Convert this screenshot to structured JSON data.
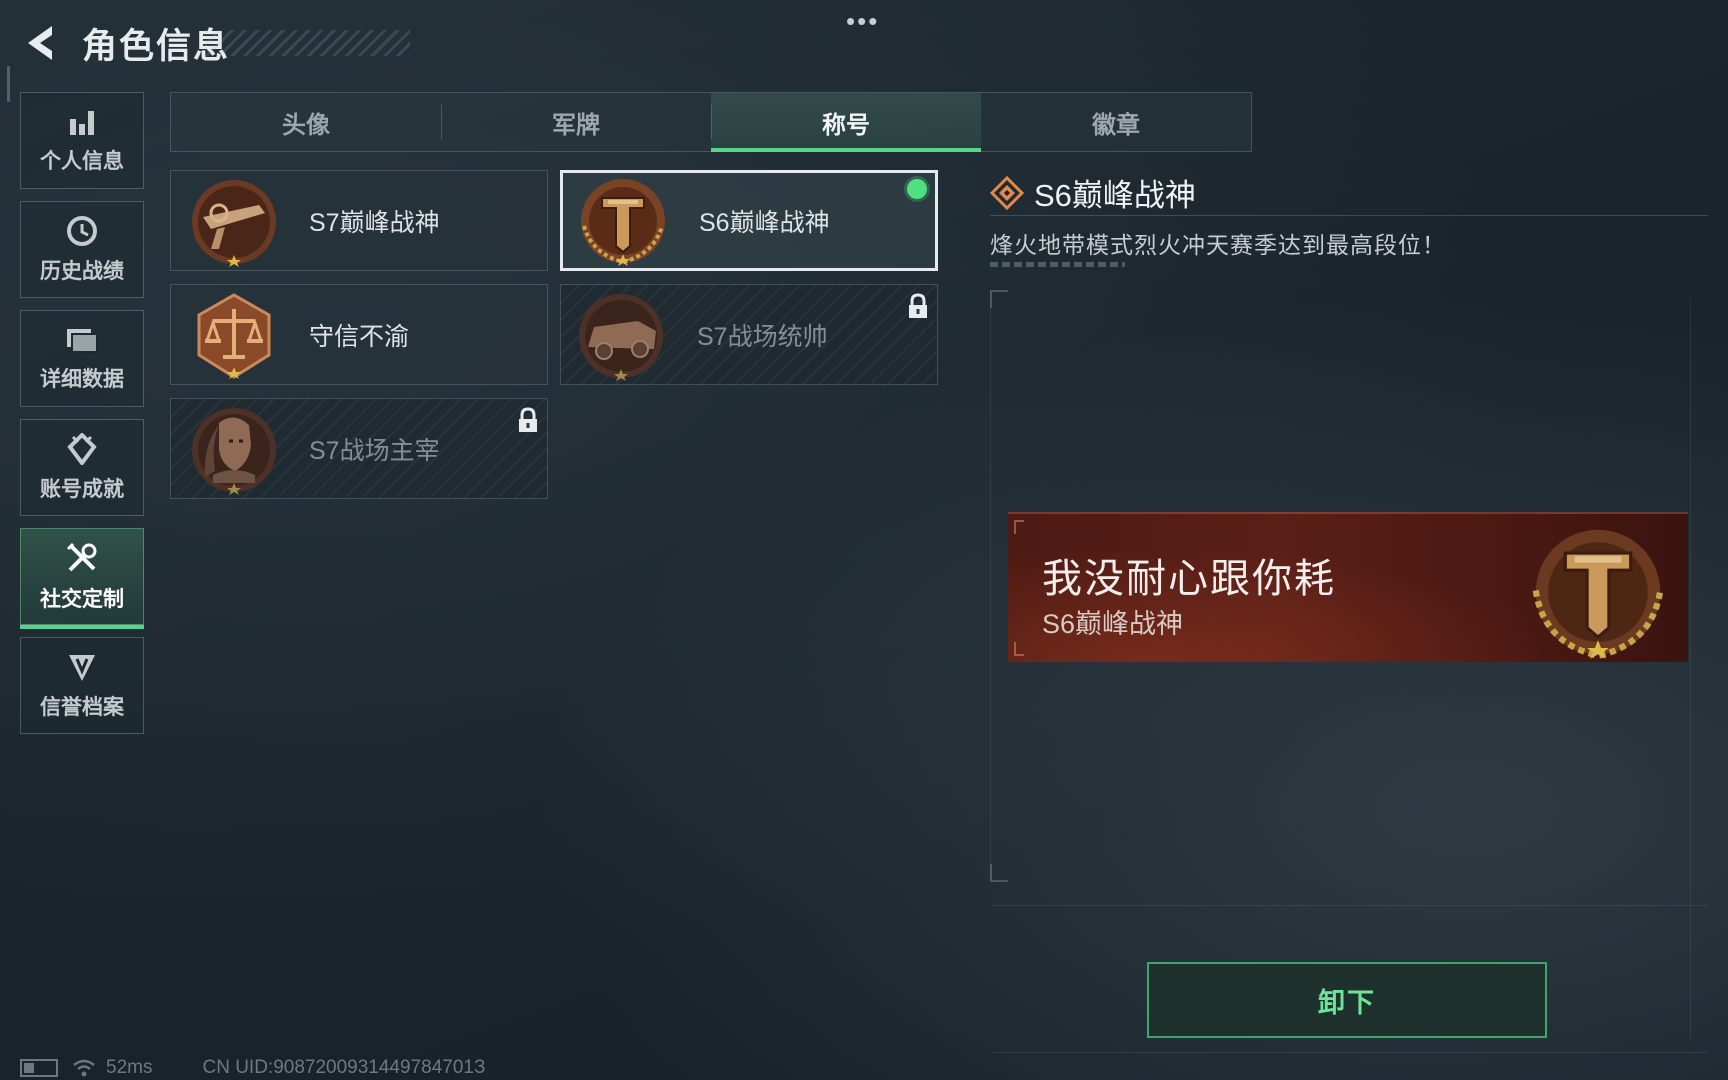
{
  "header": {
    "title": "角色信息",
    "more": "•••"
  },
  "sidebar": {
    "items": [
      {
        "label": "个人信息",
        "icon": "bar-chart-icon",
        "active": false
      },
      {
        "label": "历史战绩",
        "icon": "clock-icon",
        "active": false
      },
      {
        "label": "详细数据",
        "icon": "folder-icon",
        "active": false
      },
      {
        "label": "账号成就",
        "icon": "achievement-icon",
        "active": false
      },
      {
        "label": "社交定制",
        "icon": "tools-icon",
        "active": true
      },
      {
        "label": "信誉档案",
        "icon": "shield-icon",
        "active": false
      }
    ]
  },
  "tabs": [
    {
      "label": "头像",
      "active": false
    },
    {
      "label": "军牌",
      "active": false
    },
    {
      "label": "称号",
      "active": true
    },
    {
      "label": "徽章",
      "active": false
    }
  ],
  "titles": [
    {
      "name": "S7巅峰战神",
      "medal": "crossbow-medal-icon",
      "locked": false,
      "selected": false,
      "equipped": false
    },
    {
      "name": "S6巅峰战神",
      "medal": "t-emblem-medal-icon",
      "locked": false,
      "selected": true,
      "equipped": true
    },
    {
      "name": "守信不渝",
      "medal": "scales-medal-icon",
      "locked": false,
      "selected": false,
      "equipped": false
    },
    {
      "name": "S7战场统帅",
      "medal": "vehicle-medal-icon",
      "locked": true,
      "selected": false,
      "equipped": false
    },
    {
      "name": "S7战场主宰",
      "medal": "warrior-medal-icon",
      "locked": true,
      "selected": false,
      "equipped": false
    }
  ],
  "detail": {
    "name": "S6巅峰战神",
    "description": "烽火地带模式烈火冲天赛季达到最高段位！"
  },
  "banner": {
    "player_name": "我没耐心跟你耗",
    "title": "S6巅峰战神"
  },
  "actions": {
    "unequip_label": "卸下"
  },
  "status_bar": {
    "ping": "52ms",
    "uid": "CN UID:9087200931449784701З"
  },
  "colors": {
    "accent_green": "#57d38a",
    "medal_bronze": "#b07a3e",
    "banner_red": "#5a1f17"
  }
}
